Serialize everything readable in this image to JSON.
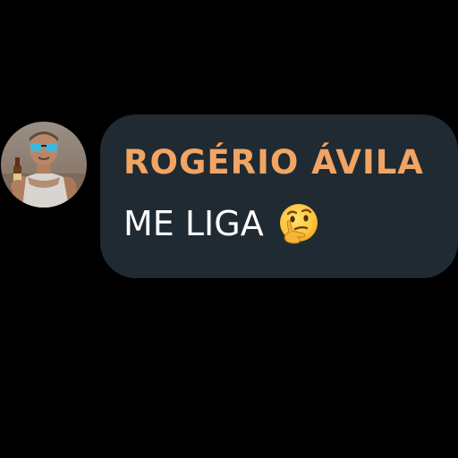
{
  "message": {
    "sender_name": "ROGÉRIO ÁVILA",
    "text": "ME LIGA",
    "emoji": "thinking-face-icon"
  },
  "colors": {
    "background": "#000000",
    "bubble": "#1f2a32",
    "sender_name": "#f1a463",
    "text": "#ffffff"
  }
}
